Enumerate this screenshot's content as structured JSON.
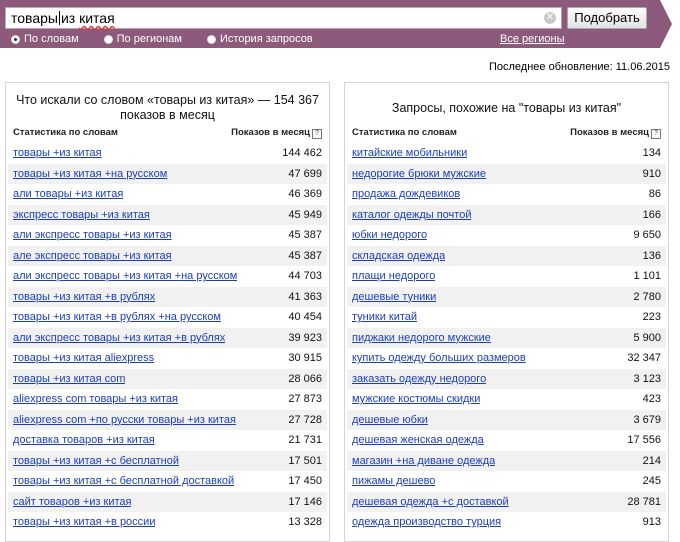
{
  "search": {
    "query_part1": "товары",
    "query_part2": "из",
    "query_part3": "китая",
    "submit_label": "Подобрать"
  },
  "modes": [
    {
      "label": "По словам",
      "selected": true
    },
    {
      "label": "По регионам",
      "selected": false
    },
    {
      "label": "История запросов",
      "selected": false
    }
  ],
  "regions_link": "Все регионы",
  "last_update": "Последнее обновление: 11.06.2015",
  "left_panel": {
    "title": "Что искали со словом «товары из китая» — 154 367 показов в месяц",
    "col_query": "Статистика по словам",
    "col_count": "Показов в месяц",
    "rows": [
      {
        "q": "товары +из китая",
        "n": "144 462"
      },
      {
        "q": "товары +из китая +на русском",
        "n": "47 699"
      },
      {
        "q": "али товары +из китая",
        "n": "46 369"
      },
      {
        "q": "экспресс товары +из китая",
        "n": "45 949"
      },
      {
        "q": "али экспресс товары +из китая",
        "n": "45 387"
      },
      {
        "q": "але экспресс товары +из китая",
        "n": "45 387"
      },
      {
        "q": "али экспресс товары +из китая +на русском",
        "n": "44 703"
      },
      {
        "q": "товары +из китая +в рублях",
        "n": "41 363"
      },
      {
        "q": "товары +из китая +в рублях +на русском",
        "n": "40 454"
      },
      {
        "q": "али экспресс товары +из китая +в рублях",
        "n": "39 923"
      },
      {
        "q": "товары +из китая aliexpress",
        "n": "30 915"
      },
      {
        "q": "товары +из китая com",
        "n": "28 066"
      },
      {
        "q": "aliexpress com товары +из китая",
        "n": "27 873"
      },
      {
        "q": "aliexpress com +по русски товары +из китая",
        "n": "27 728"
      },
      {
        "q": "доставка товаров +из китая",
        "n": "21 731"
      },
      {
        "q": "товары +из китая +с бесплатной",
        "n": "17 501"
      },
      {
        "q": "товары +из китая +с бесплатной доставкой",
        "n": "17 450"
      },
      {
        "q": "сайт товаров +из китая",
        "n": "17 146"
      },
      {
        "q": "товары +из китая +в россии",
        "n": "13 328"
      }
    ]
  },
  "right_panel": {
    "title": "Запросы, похожие на \"товары из китая\"",
    "col_query": "Статистика по словам",
    "col_count": "Показов в месяц",
    "rows": [
      {
        "q": "китайские мобильники",
        "n": "134"
      },
      {
        "q": "недорогие брюки мужские",
        "n": "910"
      },
      {
        "q": "продажа дождевиков",
        "n": "86"
      },
      {
        "q": "каталог одежды почтой",
        "n": "166"
      },
      {
        "q": "юбки недорого",
        "n": "9 650"
      },
      {
        "q": "складская одежда",
        "n": "136"
      },
      {
        "q": "плащи недорого",
        "n": "1 101"
      },
      {
        "q": "дешевые туники",
        "n": "2 780"
      },
      {
        "q": "туники китай",
        "n": "223"
      },
      {
        "q": "пиджаки недорого мужские",
        "n": "5 900"
      },
      {
        "q": "купить одежду больших размеров",
        "n": "32 347"
      },
      {
        "q": "заказать одежду недорого",
        "n": "3 123"
      },
      {
        "q": "мужские костюмы скидки",
        "n": "423"
      },
      {
        "q": "дешевые юбки",
        "n": "3 679"
      },
      {
        "q": "дешевая женская одежда",
        "n": "17 556"
      },
      {
        "q": "магазин +на диване одежда",
        "n": "214"
      },
      {
        "q": "пижамы дешево",
        "n": "245"
      },
      {
        "q": "дешевая одежда +с доставкой",
        "n": "28 781"
      },
      {
        "q": "одежда производство турция",
        "n": "913"
      }
    ]
  },
  "colors": {
    "band": "#8e5a7c",
    "link": "#1a3dc1",
    "stripe": "#f1f1f1"
  }
}
